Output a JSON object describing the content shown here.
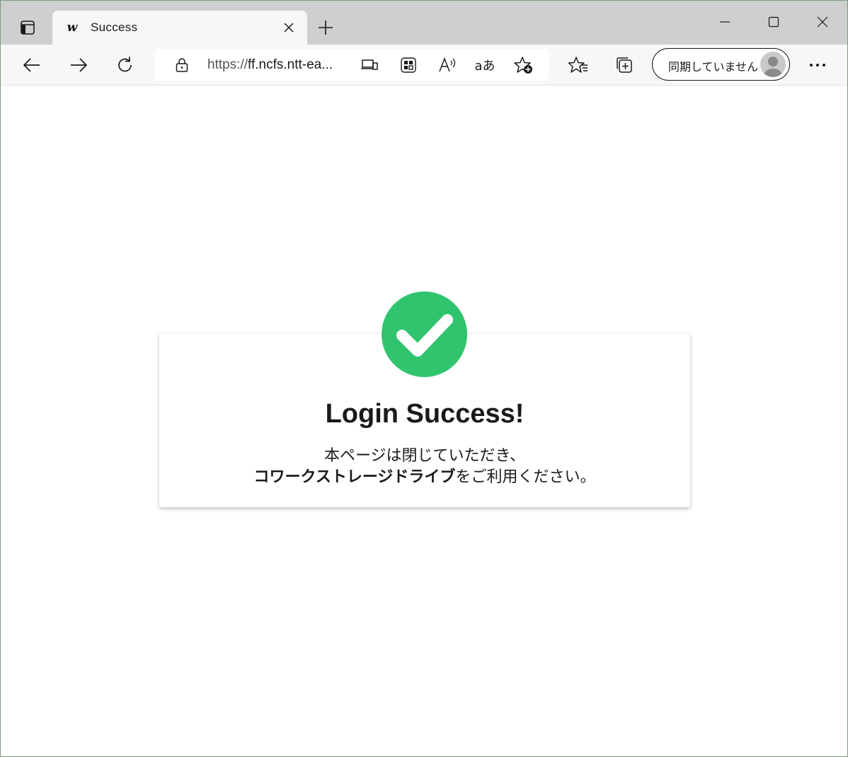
{
  "tab": {
    "favicon_text": "w",
    "title": "Success"
  },
  "address_bar": {
    "url_scheme": "https://",
    "url_rest": "ff.ncfs.ntt-ea..."
  },
  "profile": {
    "label": "同期していません"
  },
  "card": {
    "title": "Login Success!",
    "line1": "本ページは閉じていただき、",
    "line2_bold": "コワークストレージドライブ",
    "line2_rest": "をご利用ください。"
  },
  "colors": {
    "success_green": "#31c46f",
    "tabstrip": "#cfcfcf",
    "toolbar": "#f7f7f7"
  },
  "icons": [
    "tab-actions-icon",
    "close-icon",
    "plus-icon",
    "minimize-icon",
    "maximize-icon",
    "window-close-icon",
    "back-arrow-icon",
    "forward-arrow-icon",
    "refresh-icon",
    "lock-icon",
    "device-icon",
    "qr-apps-icon",
    "read-aloud-icon",
    "translate-icon",
    "add-favorite-icon",
    "favorites-icon",
    "collections-icon",
    "avatar-icon",
    "more-icon",
    "checkmark-icon"
  ]
}
